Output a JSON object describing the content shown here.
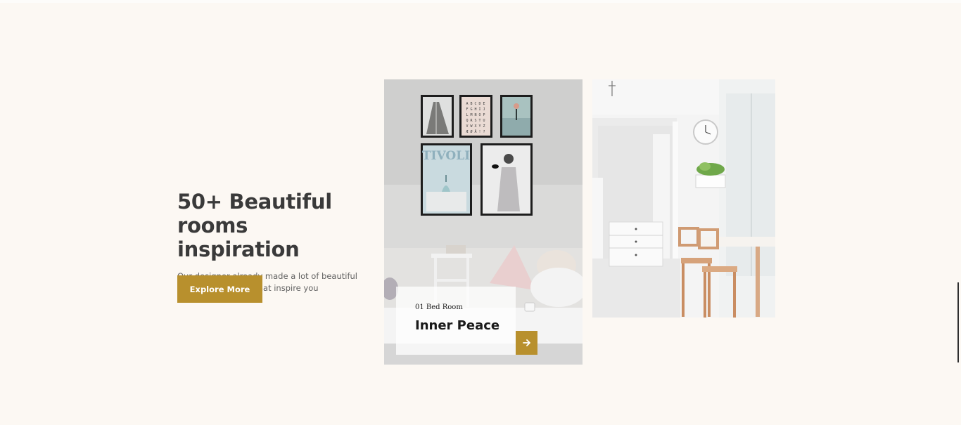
{
  "hero": {
    "headline": "50+ Beautiful rooms inspiration",
    "subtitle": "Our designer already made a lot of beautiful prototipe of rooms that inspire you",
    "cta_label": "Explore More"
  },
  "featured_room": {
    "meta": "01 Bed Room",
    "title": "Inner Peace",
    "arrow_icon": "arrow-right-icon"
  },
  "artwork": {
    "alphabet_rows": [
      "A B C D E",
      "F G H I J",
      "L M N O P",
      "Q R S T U",
      "V W X Y Z",
      "Æ Ø Å ! ?"
    ],
    "poster_word": "TIVOLI"
  },
  "colors": {
    "background": "#fcf8f3",
    "accent": "#b8902d",
    "heading": "#3a3a3a",
    "body_text": "#616161"
  }
}
